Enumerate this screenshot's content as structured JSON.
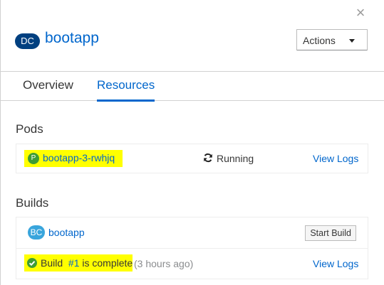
{
  "close_symbol": "×",
  "header": {
    "kind_abbr": "DC",
    "title": "bootapp",
    "actions_label": "Actions"
  },
  "tabs": [
    {
      "label": "Overview",
      "active": false
    },
    {
      "label": "Resources",
      "active": true
    }
  ],
  "pods": {
    "title": "Pods",
    "items": [
      {
        "kind_abbr": "P",
        "name": "bootapp-3-rwhjq",
        "status": "Running",
        "status_icon": "refresh-icon",
        "view_logs": "View Logs"
      }
    ]
  },
  "builds": {
    "title": "Builds",
    "config": {
      "kind_abbr": "BC",
      "name": "bootapp",
      "start_build_label": "Start Build"
    },
    "latest": {
      "status_icon": "check-circle-icon",
      "build_text": "Build",
      "build_number": "#1",
      "status_text": "is complete",
      "time_ago": "(3 hours ago)",
      "view_logs": "View Logs"
    }
  },
  "colors": {
    "link": "#0066cc",
    "dc_badge": "#004080",
    "bc_badge": "#39a5dc",
    "pod_badge": "#3f9c35",
    "success": "#3f9c35",
    "highlight": "#ffff00"
  }
}
